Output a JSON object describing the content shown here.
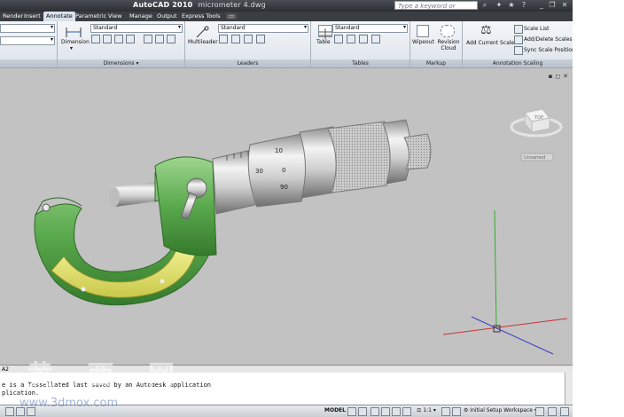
{
  "app": {
    "title": "AutoCAD 2010",
    "document": "micrometer 4.dwg",
    "search_placeholder": "Type a keyword or phrase"
  },
  "tabs": [
    "Render",
    "Insert",
    "Annotate",
    "Parametric",
    "View",
    "Manage",
    "Output",
    "Express Tools"
  ],
  "active_tab": "Annotate",
  "ribbon": {
    "dimensions": {
      "button": "Dimension",
      "style": "Standard",
      "panel_label": "Dimensions"
    },
    "leaders": {
      "button": "Multileader",
      "style": "Standard",
      "panel_label": "Leaders"
    },
    "tables": {
      "button": "Table",
      "style": "Standard",
      "panel_label": "Tables"
    },
    "markup": {
      "wipeout": "Wipeout",
      "revcloud": "Revision Cloud",
      "panel_label": "Markup"
    },
    "annotation_scaling": {
      "add_current": "Add Current Scale",
      "scale_list": "Scale List",
      "add_delete": "Add/Delete Scales",
      "sync": "Sync Scale Positions",
      "panel_label": "Annotation Scaling"
    }
  },
  "viewcube": {
    "face": "TOP",
    "wcs": "Unnamed"
  },
  "command_line": {
    "prefix": "A2",
    "line1": "e is a Tessellated last saved by an Autodesk application",
    "line2": "plication."
  },
  "status_bar": {
    "model": "MODEL",
    "scale": "1:1",
    "workspace": "Initial Setup Workspace"
  },
  "watermark": {
    "text": "黄 西 网",
    "url": "www.3dmox.com"
  },
  "colors": {
    "viewport_bg": "#c2c2c2",
    "frame_green": "#5aa94d",
    "pad_yellow": "#e4e36a",
    "title_bar": "#2b2e33"
  }
}
